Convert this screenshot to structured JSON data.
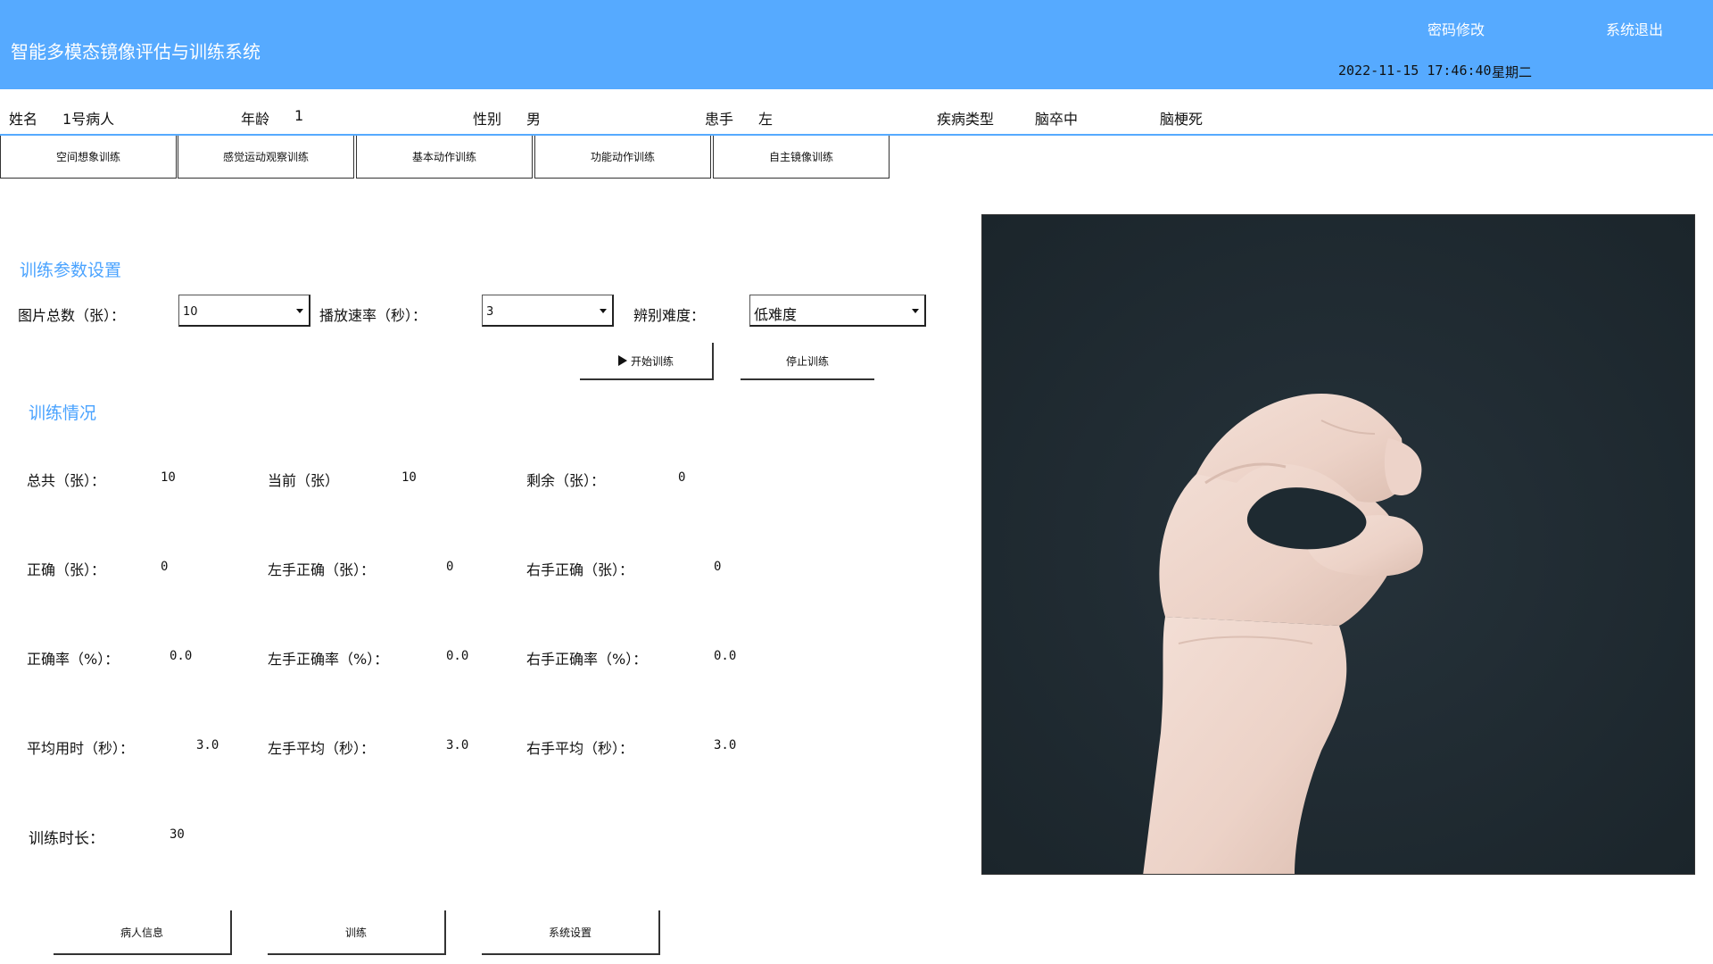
{
  "header": {
    "title": "智能多模态镜像评估与训练系统",
    "change_password": "密码修改",
    "logout": "系统退出",
    "datetime": "2022-11-15 17:46:40",
    "weekday": "星期二"
  },
  "patient": {
    "name_label": "姓名",
    "name": "1号病人",
    "age_label": "年龄",
    "age": "1",
    "gender_label": "性别",
    "gender": "男",
    "affected_label": "患手",
    "affected": "左",
    "disease_label": "疾病类型",
    "disease": "脑卒中",
    "disease_detail": "脑梗死"
  },
  "tabs": [
    {
      "label": "空间想象训练"
    },
    {
      "label": "感觉运动观察训练"
    },
    {
      "label": "基本动作训练"
    },
    {
      "label": "功能动作训练"
    },
    {
      "label": "自主镜像训练"
    }
  ],
  "params": {
    "title": "训练参数设置",
    "count_label": "图片总数（张）：",
    "count_value": "10",
    "speed_label": "播放速率（秒）：",
    "speed_value": "3",
    "difficulty_label": "辨别难度：",
    "difficulty_value": "低难度",
    "start_button": "开始训练",
    "stop_button": "停止训练"
  },
  "stats": {
    "title": "训练情况",
    "total_label": "总共（张）：",
    "total": "10",
    "current_label": "当前（张）",
    "current": "10",
    "remaining_label": "剩余（张）：",
    "remaining": "0",
    "correct_label": "正确（张）：",
    "correct": "0",
    "left_correct_label": "左手正确（张）：",
    "left_correct": "0",
    "right_correct_label": "右手正确（张）：",
    "right_correct": "0",
    "rate_label": "正确率（%）：",
    "rate": "0.0",
    "left_rate_label": "左手正确率（%）：",
    "left_rate": "0.0",
    "right_rate_label": "右手正确率（%）：",
    "right_rate": "0.0",
    "avg_label": "平均用时（秒）：",
    "avg": "3.0",
    "left_avg_label": "左手平均（秒）：",
    "left_avg": "3.0",
    "right_avg_label": "右手平均（秒）：",
    "right_avg": "3.0",
    "duration_label": "训练时长：",
    "duration": "30"
  },
  "bottom_nav": {
    "patient_info": "病人信息",
    "training": "训练",
    "settings": "系统设置"
  },
  "colors": {
    "header_bg": "#56aaff",
    "section_title": "#4aa3ff",
    "photo_bg": "#1f2a30"
  }
}
